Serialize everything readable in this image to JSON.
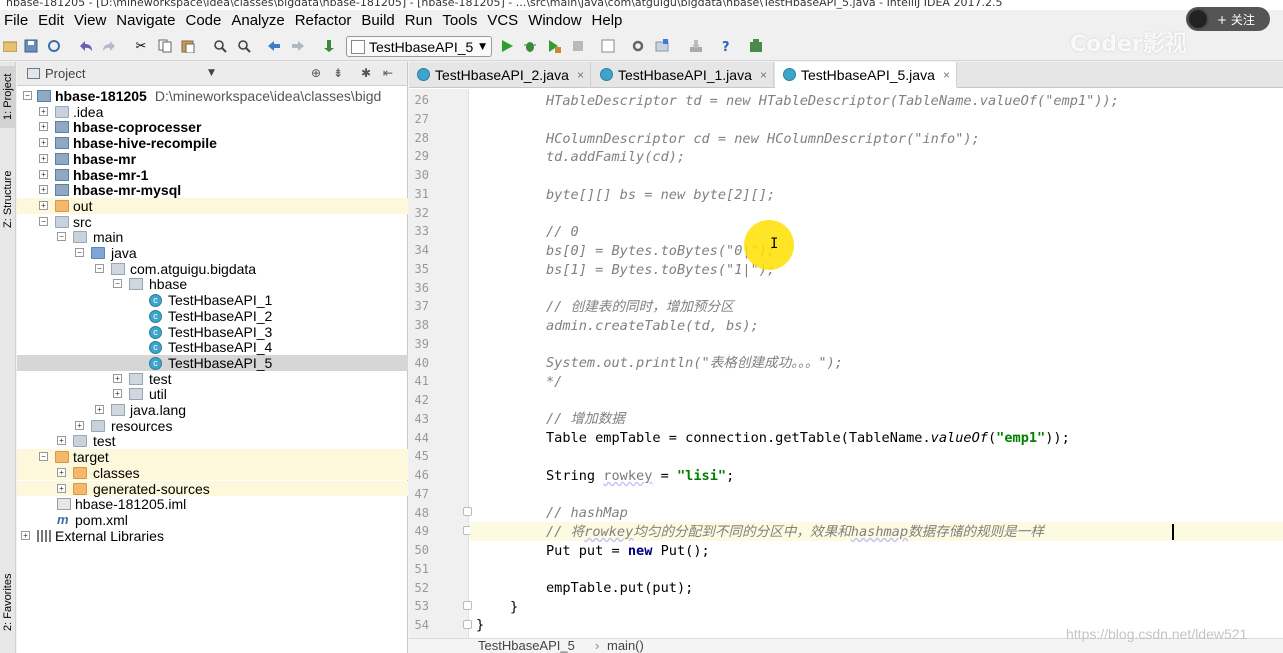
{
  "window": {
    "title": "hbase-181205 - [D:\\mineworkspace\\idea\\classes\\bigdata\\hbase-181205] - [hbase-181205] - ...\\src\\main\\java\\com\\atguigu\\bigdata\\hbase\\TestHbaseAPI_5.java - IntelliJ IDEA 2017.2.5"
  },
  "menu": [
    "File",
    "Edit",
    "View",
    "Navigate",
    "Code",
    "Analyze",
    "Refactor",
    "Build",
    "Run",
    "Tools",
    "VCS",
    "Window",
    "Help"
  ],
  "overlay": {
    "follow_label": "+ 关注",
    "brand": "Coder影视",
    "url": "https://blog.csdn.net/ldew521"
  },
  "toolbar": {
    "run_config": "TestHbaseAPI_5"
  },
  "left_strip": {
    "project_tab": "1: Project",
    "structure_tab": "Z: Structure",
    "favorites_tab": "2: Favorites"
  },
  "project": {
    "title": "Project",
    "tree": [
      {
        "label": "hbase-181205",
        "path": "D:\\mineworkspace\\idea\\classes\\bigd"
      },
      {
        "label": ".idea"
      },
      {
        "label": "hbase-coprocesser"
      },
      {
        "label": "hbase-hive-recompile"
      },
      {
        "label": "hbase-mr"
      },
      {
        "label": "hbase-mr-1"
      },
      {
        "label": "hbase-mr-mysql"
      },
      {
        "label": "out"
      },
      {
        "label": "src"
      },
      {
        "label": "main"
      },
      {
        "label": "java"
      },
      {
        "label": "com.atguigu.bigdata"
      },
      {
        "label": "hbase"
      },
      {
        "label": "TestHbaseAPI_1"
      },
      {
        "label": "TestHbaseAPI_2"
      },
      {
        "label": "TestHbaseAPI_3"
      },
      {
        "label": "TestHbaseAPI_4"
      },
      {
        "label": "TestHbaseAPI_5"
      },
      {
        "label": "test"
      },
      {
        "label": "util"
      },
      {
        "label": "java.lang"
      },
      {
        "label": "resources"
      },
      {
        "label": "test"
      },
      {
        "label": "target"
      },
      {
        "label": "classes"
      },
      {
        "label": "generated-sources"
      },
      {
        "label": "hbase-181205.iml"
      },
      {
        "label": "pom.xml"
      },
      {
        "label": "External Libraries"
      }
    ]
  },
  "editor": {
    "tabs": [
      "TestHbaseAPI_2.java",
      "TestHbaseAPI_1.java",
      "TestHbaseAPI_5.java"
    ],
    "active_tab": "TestHbaseAPI_5.java",
    "line_numbers": [
      "26",
      "27",
      "28",
      "29",
      "30",
      "31",
      "32",
      "33",
      "34",
      "35",
      "36",
      "37",
      "38",
      "39",
      "40",
      "41",
      "42",
      "43",
      "44",
      "45",
      "46",
      "47",
      "48",
      "49",
      "50",
      "51",
      "52",
      "53",
      "54"
    ],
    "code": {
      "l26": "HTableDescriptor td = new HTableDescriptor(TableName.valueOf(\"emp1\"));",
      "l28": "HColumnDescriptor cd = new HColumnDescriptor(\"info\");",
      "l29": "td.addFamily(cd);",
      "l31": "byte[][] bs = new byte[2][];",
      "l33": "// 0",
      "l34": "bs[0] = Bytes.toBytes(\"0|\");",
      "l35": "bs[1] = Bytes.toBytes(\"1|\");",
      "l37": "// 创建表的同时，增加预分区",
      "l38": "admin.createTable(td, bs);",
      "l40": "System.out.println(\"表格创建成功。。。\");",
      "l41": "*/",
      "l43": "// 增加数据",
      "l44_a": "Table empTable = connection.getTable(TableName.",
      "l44_b": "valueOf",
      "l44_c": "(",
      "l44_d": "\"emp1\"",
      "l44_e": "));",
      "l46_a": "String ",
      "l46_b": "rowkey",
      "l46_c": " = ",
      "l46_d": "\"lisi\"",
      "l46_e": ";",
      "l48": "// hashMap",
      "l49_a": "// 将",
      "l49_b": "rowkey",
      "l49_c": "均匀的分配到不同的分区中，效果和",
      "l49_d": "hashmap",
      "l49_e": "数据存储的规则是一样",
      "l50_a": "Put put = ",
      "l50_b": "new",
      "l50_c": " Put();",
      "l52": "empTable.put(put);",
      "l53": "}",
      "l54": "}"
    },
    "breadcrumb": [
      "TestHbaseAPI_5",
      "main()"
    ]
  }
}
